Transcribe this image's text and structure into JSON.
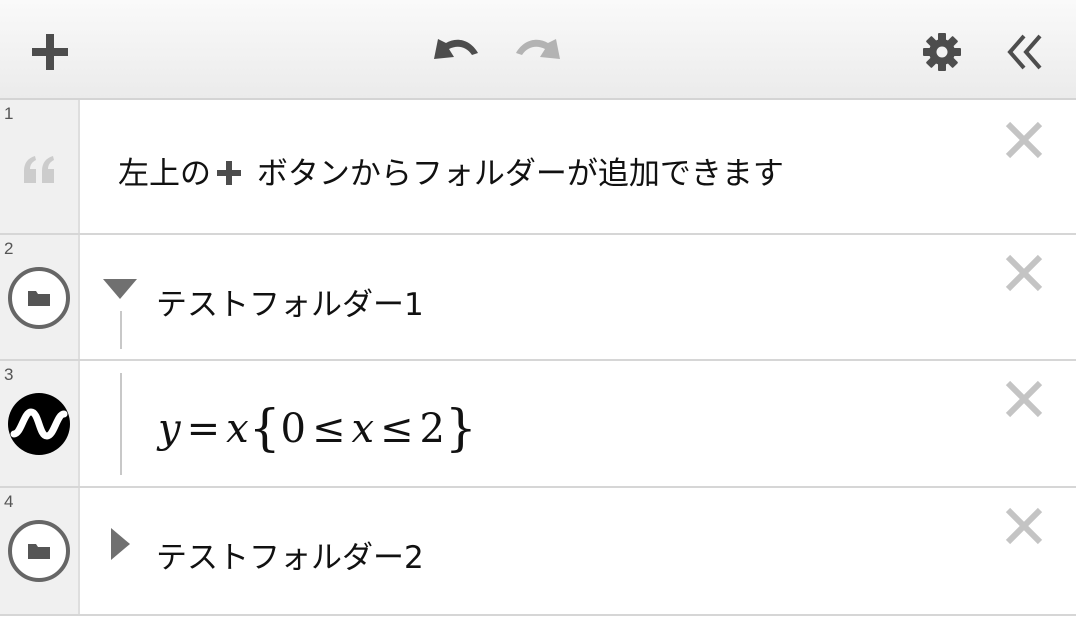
{
  "toolbar": {
    "add_icon": "plus-icon",
    "undo_icon": "undo-icon",
    "redo_icon": "redo-icon",
    "settings_icon": "gear-icon",
    "collapse_icon": "double-chevron-left-icon"
  },
  "expressions": [
    {
      "index": "1",
      "type": "note",
      "icon": "quote-icon",
      "text_before": "左上の",
      "text_icon": "plus-icon",
      "text_after": " ボタンからフォルダーが追加できます"
    },
    {
      "index": "2",
      "type": "folder",
      "icon": "folder-icon",
      "expanded": true,
      "title": "テストフォルダー1"
    },
    {
      "index": "3",
      "type": "expression",
      "icon": "graph-wave-icon",
      "in_folder": true,
      "latex": "y=x\\{0\\le x\\le 2\\}",
      "tokens": {
        "y": "y",
        "eq": "=",
        "x1": "x",
        "lbrace": "{",
        "zero": "0",
        "le1": "≤",
        "x2": "x",
        "le2": "≤",
        "two": "2",
        "rbrace": "}"
      }
    },
    {
      "index": "4",
      "type": "folder",
      "icon": "folder-icon",
      "expanded": false,
      "title": "テストフォルダー2"
    }
  ],
  "colors": {
    "icon_gray": "#4d4d4d",
    "disabled_gray": "#b3b3b3",
    "delete_gray": "#c4c4c4",
    "gutter": "#f0f0f0"
  }
}
